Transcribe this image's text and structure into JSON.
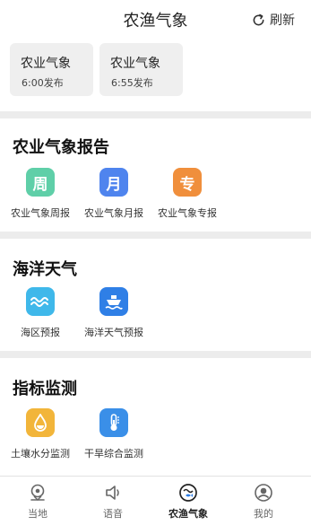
{
  "header": {
    "title": "农渔气象",
    "refresh_label": "刷新"
  },
  "top_cards": [
    {
      "title": "农业气象",
      "time": "6:00发布"
    },
    {
      "title": "农业气象",
      "time": "6:55发布"
    }
  ],
  "sections": [
    {
      "title": "农业气象报告",
      "items": [
        {
          "glyph": "周",
          "label": "农业气象周报",
          "color": "#5fcfa8"
        },
        {
          "glyph": "月",
          "label": "农业气象月报",
          "color": "#4f84ee"
        },
        {
          "glyph": "专",
          "label": "农业气象专报",
          "color": "#f08f3c"
        }
      ]
    },
    {
      "title": "海洋天气",
      "items": [
        {
          "icon": "sea-waves-icon",
          "label": "海区预报",
          "color": "#3fb8ea"
        },
        {
          "icon": "ship-icon",
          "label": "海洋天气预报",
          "color": "#2f7fe6"
        }
      ]
    },
    {
      "title": "指标监测",
      "items": [
        {
          "icon": "water-drop-icon",
          "label": "土壤水分监测",
          "color": "#f2b53a"
        },
        {
          "icon": "thermometer-icon",
          "label": "干旱综合监测",
          "color": "#3a8fe8"
        }
      ]
    }
  ],
  "bottom_nav": [
    {
      "label": "当地",
      "icon": "location-icon"
    },
    {
      "label": "语音",
      "icon": "speaker-icon"
    },
    {
      "label": "农渔气象",
      "icon": "farm-fish-icon",
      "active": true
    },
    {
      "label": "我的",
      "icon": "profile-icon"
    }
  ]
}
